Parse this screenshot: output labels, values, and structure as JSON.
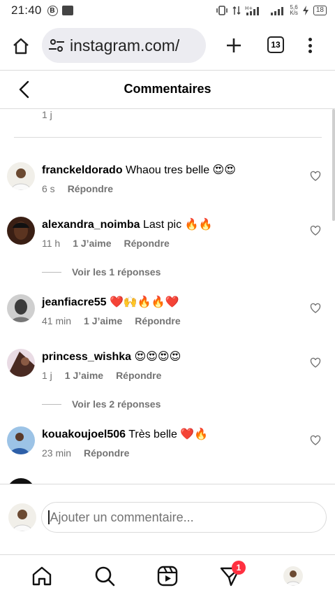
{
  "status_bar": {
    "time": "21:40",
    "b_icon": "B",
    "speed_top": "5,6",
    "speed_bottom": "K/s",
    "battery": "18"
  },
  "browser": {
    "url": "instagram.com/",
    "tab_count": "13"
  },
  "header": {
    "title": "Commentaires"
  },
  "previous_meta": "1 j",
  "comments": [
    {
      "username": "franckeldorado",
      "text": "Whaou tres belle 😍😍",
      "time": "6 s",
      "likes": "",
      "reply": "Répondre"
    },
    {
      "username": "alexandra_noimba",
      "text": "Last pic 🔥🔥",
      "time": "11 h",
      "likes": "1 J’aime",
      "reply": "Répondre"
    },
    {
      "username": "jeanfiacre55",
      "text": "❤️🙌🔥🔥❤️",
      "time": "41 min",
      "likes": "1 J’aime",
      "reply": "Répondre"
    },
    {
      "username": "princess_wishka",
      "text": "😍😍😍😍",
      "time": "1 j",
      "likes": "1 J’aime",
      "reply": "Répondre"
    },
    {
      "username": "kouakoujoel506",
      "text": "Très belle ❤️🔥",
      "time": "23 min",
      "likes": "",
      "reply": "Répondre"
    }
  ],
  "replies": [
    {
      "label": "Voir les 1 réponses"
    },
    {
      "label": "Voir les 2 réponses"
    }
  ],
  "composer": {
    "placeholder": "Ajouter un commentaire..."
  },
  "nav": {
    "notification_badge": "1"
  },
  "colors": {
    "secondary_text": "#737373",
    "badge": "#ff3040",
    "url_pill": "#ececf1"
  }
}
